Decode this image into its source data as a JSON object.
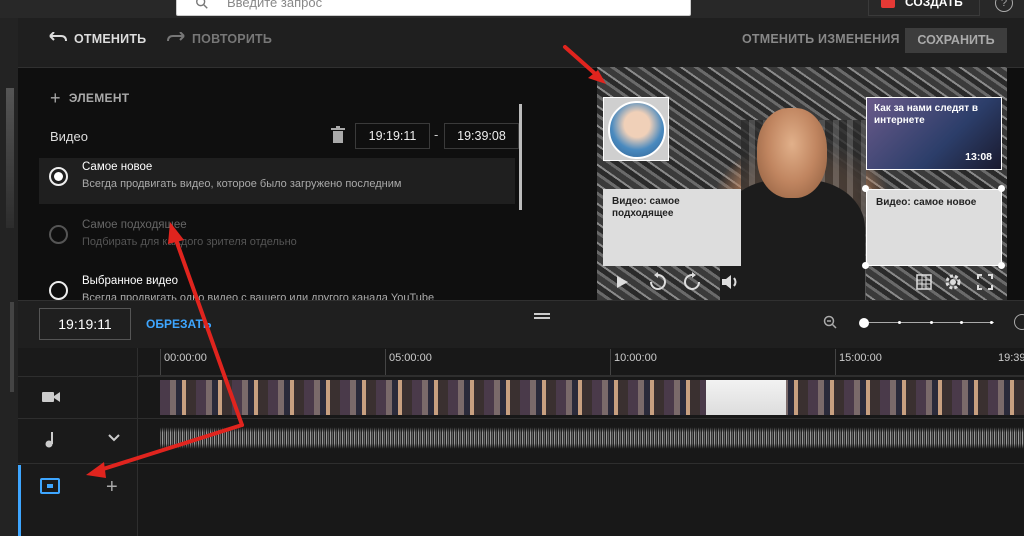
{
  "header": {
    "search_placeholder": "Введите запрос",
    "create_label": "СОЗДАТЬ",
    "help_glyph": "?"
  },
  "toolbar": {
    "undo_label": "ОТМЕНИТЬ",
    "redo_label": "ПОВТОРИТЬ",
    "discard_label": "ОТМЕНИТЬ ИЗМЕНЕНИЯ",
    "save_label": "СОХРАНИТЬ"
  },
  "panel": {
    "add_element_label": "ЭЛЕМЕНТ",
    "section_label": "Видео",
    "start_time": "19:19:11",
    "end_time": "19:39:08",
    "dash": "-",
    "options": [
      {
        "title": "Самое новое",
        "desc": "Всегда продвигать видео, которое было загружено последним",
        "selected": true,
        "disabled": false
      },
      {
        "title": "Самое подходящее",
        "desc": "Подбирать для каждого зрителя отдельно",
        "selected": false,
        "disabled": true
      },
      {
        "title": "Выбранное видео",
        "desc": "Всегда продвигать одно видео с вашего или другого канала YouTube",
        "selected": false,
        "disabled": false
      }
    ]
  },
  "preview": {
    "card_top_right_title": "Как за нами следят в интернете",
    "card_top_right_duration": "13:08",
    "card_bottom_left_label": "Видео: самое подходящее",
    "card_bottom_right_label": "Видео: самое новое"
  },
  "timeline": {
    "current_time": "19:19:11",
    "trim_label": "ОБРЕЗАТЬ",
    "ticks": [
      "00:00:00",
      "05:00:00",
      "10:00:00",
      "15:00:00",
      "19:39"
    ]
  },
  "colors": {
    "accent": "#3ea6ff",
    "annotation_arrow": "#e0241e",
    "brand_red": "#e53935"
  }
}
